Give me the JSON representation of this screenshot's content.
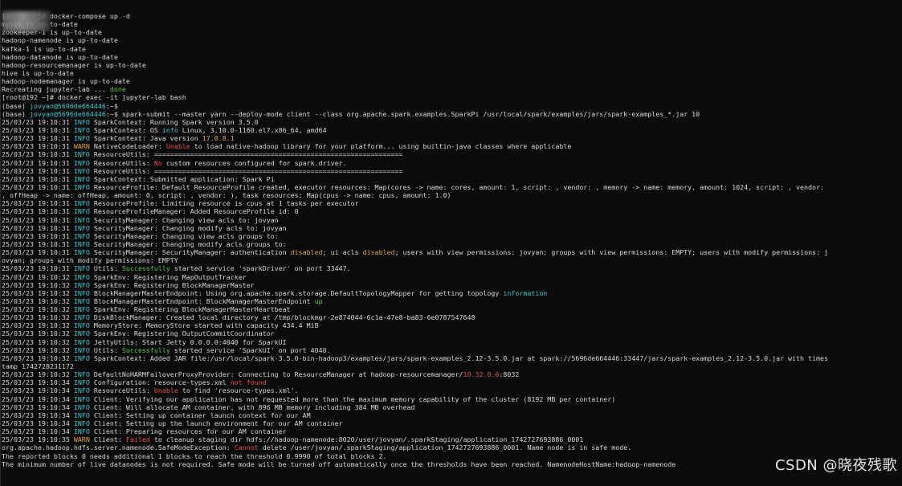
{
  "terminal": {
    "lines": [
      [
        [
          "plain",
          "[r   o   ]# docker-compose up -d"
        ]
      ],
      [
        [
          "plain",
          "mysql is up-to-date"
        ]
      ],
      [
        [
          "plain",
          "zookeeper-1 is up-to-date"
        ]
      ],
      [
        [
          "plain",
          "hadoop-namenode is up-to-date"
        ]
      ],
      [
        [
          "plain",
          "kafka-1 is up-to-date"
        ]
      ],
      [
        [
          "plain",
          "hadoop-datanode is up-to-date"
        ]
      ],
      [
        [
          "plain",
          "hadoop-resourcemanager is up-to-date"
        ]
      ],
      [
        [
          "plain",
          "hive is up-to-date"
        ]
      ],
      [
        [
          "plain",
          "hadoop-nodemanager is up-to-date"
        ]
      ],
      [
        [
          "plain",
          "Recreating jupyter-lab ... "
        ],
        [
          "green",
          "done"
        ]
      ],
      [
        [
          "plain",
          "[root@192 ~]# docker exec -it jupyter-lab bash"
        ]
      ],
      [
        [
          "plain",
          "(base) "
        ],
        [
          "cyan",
          "jovyan@5696de664446"
        ],
        [
          "plain",
          ":~$"
        ]
      ],
      [
        [
          "plain",
          "(base) "
        ],
        [
          "cyan",
          "jovyan@5696de664446"
        ],
        [
          "plain",
          ":~$ spark-submit --master yarn --deploy-mode client --class org.apache.spark.examples.SparkPi /usr/local/spark/examples/jars/spark-examples_*.jar 10"
        ]
      ],
      [
        [
          "plain",
          "25/03/23 19:10:31 "
        ],
        [
          "cyan",
          "INFO"
        ],
        [
          "plain",
          " SparkContext: Running Spark version 3.5.0"
        ]
      ],
      [
        [
          "plain",
          "25/03/23 19:10:31 "
        ],
        [
          "cyan",
          "INFO"
        ],
        [
          "plain",
          " SparkContext: OS "
        ],
        [
          "cyan",
          "info"
        ],
        [
          "plain",
          " Linux, 3.10.0-1160.el7.x86_64, amd64"
        ]
      ],
      [
        [
          "plain",
          "25/03/23 19:10:31 "
        ],
        [
          "cyan",
          "INFO"
        ],
        [
          "plain",
          " SparkContext: Java version "
        ],
        [
          "orange",
          "17.0.8.1"
        ]
      ],
      [
        [
          "plain",
          "25/03/23 19:10:31 "
        ],
        [
          "orange",
          "WARN"
        ],
        [
          "plain",
          " NativeCodeLoader: "
        ],
        [
          "red",
          "Unable"
        ],
        [
          "plain",
          " to load native-hadoop library for your platform... using builtin-java classes where applicable"
        ]
      ],
      [
        [
          "plain",
          "25/03/23 19:10:31 "
        ],
        [
          "cyan",
          "INFO"
        ],
        [
          "plain",
          " ResourceUtils: =============================================================="
        ]
      ],
      [
        [
          "plain",
          "25/03/23 19:10:31 "
        ],
        [
          "cyan",
          "INFO"
        ],
        [
          "plain",
          " ResourceUtils: "
        ],
        [
          "red",
          "No"
        ],
        [
          "plain",
          " custom resources configured for spark.driver."
        ]
      ],
      [
        [
          "plain",
          "25/03/23 19:10:31 "
        ],
        [
          "cyan",
          "INFO"
        ],
        [
          "plain",
          " ResourceUtils: =============================================================="
        ]
      ],
      [
        [
          "plain",
          "25/03/23 19:10:31 "
        ],
        [
          "cyan",
          "INFO"
        ],
        [
          "plain",
          " SparkContext: Submitted application: Spark Pi"
        ]
      ],
      [
        [
          "plain",
          "25/03/23 19:10:31 "
        ],
        [
          "cyan",
          "INFO"
        ],
        [
          "plain",
          " ResourceProfile: Default ResourceProfile created, executor resources: Map(cores -> name: cores, amount: 1, script: , vendor: , memory -> name: memory, amount: 1024, script: , vendor:"
        ]
      ],
      [
        [
          "plain",
          ", offHeap -> name: offHeap, amount: 0, script: , vendor: ), task resources: Map(cpus -> name: cpus, amount: 1.0)"
        ]
      ],
      [
        [
          "plain",
          "25/03/23 19:10:31 "
        ],
        [
          "cyan",
          "INFO"
        ],
        [
          "plain",
          " ResourceProfile: Limiting resource is cpus at 1 tasks per executor"
        ]
      ],
      [
        [
          "plain",
          "25/03/23 19:10:31 "
        ],
        [
          "cyan",
          "INFO"
        ],
        [
          "plain",
          " ResourceProfileManager: Added ResourceProfile id: 0"
        ]
      ],
      [
        [
          "plain",
          "25/03/23 19:10:31 "
        ],
        [
          "cyan",
          "INFO"
        ],
        [
          "plain",
          " SecurityManager: Changing view acls to: jovyan"
        ]
      ],
      [
        [
          "plain",
          "25/03/23 19:10:31 "
        ],
        [
          "cyan",
          "INFO"
        ],
        [
          "plain",
          " SecurityManager: Changing modify acls to: jovyan"
        ]
      ],
      [
        [
          "plain",
          "25/03/23 19:10:31 "
        ],
        [
          "cyan",
          "INFO"
        ],
        [
          "plain",
          " SecurityManager: Changing view acls groups to:"
        ]
      ],
      [
        [
          "plain",
          "25/03/23 19:10:31 "
        ],
        [
          "cyan",
          "INFO"
        ],
        [
          "plain",
          " SecurityManager: Changing modify acls groups to:"
        ]
      ],
      [
        [
          "plain",
          "25/03/23 19:10:31 "
        ],
        [
          "cyan",
          "INFO"
        ],
        [
          "plain",
          " SecurityManager: SecurityManager: authentication "
        ],
        [
          "orange",
          "disabled"
        ],
        [
          "plain",
          "; ui acls "
        ],
        [
          "orange",
          "disabled"
        ],
        [
          "plain",
          "; users with view permissions: jovyan; groups with view permissions: EMPTY; users with modify permissions: j"
        ]
      ],
      [
        [
          "plain",
          "ovyan; groups with modify permissions: EMPTY"
        ]
      ],
      [
        [
          "plain",
          "25/03/23 19:10:31 "
        ],
        [
          "cyan",
          "INFO"
        ],
        [
          "plain",
          " Utils: "
        ],
        [
          "green",
          "Successfully"
        ],
        [
          "plain",
          " started service 'sparkDriver' on port 33447."
        ]
      ],
      [
        [
          "plain",
          "25/03/23 19:10:32 "
        ],
        [
          "cyan",
          "INFO"
        ],
        [
          "plain",
          " SparkEnv: Registering MapOutputTracker"
        ]
      ],
      [
        [
          "plain",
          "25/03/23 19:10:32 "
        ],
        [
          "cyan",
          "INFO"
        ],
        [
          "plain",
          " SparkEnv: Registering BlockManagerMaster"
        ]
      ],
      [
        [
          "plain",
          "25/03/23 19:10:32 "
        ],
        [
          "cyan",
          "INFO"
        ],
        [
          "plain",
          " BlockManagerMasterEndpoint: Using org.apache.spark.storage.DefaultTopologyMapper for getting topology "
        ],
        [
          "cyan",
          "information"
        ]
      ],
      [
        [
          "plain",
          "25/03/23 19:10:32 "
        ],
        [
          "cyan",
          "INFO"
        ],
        [
          "plain",
          " BlockManagerMasterEndpoint: BlockManagerMasterEndpoint "
        ],
        [
          "green",
          "up"
        ]
      ],
      [
        [
          "plain",
          "25/03/23 19:10:32 "
        ],
        [
          "cyan",
          "INFO"
        ],
        [
          "plain",
          " SparkEnv: Registering BlockManagerMasterHeartbeat"
        ]
      ],
      [
        [
          "plain",
          "25/03/23 19:10:32 "
        ],
        [
          "cyan",
          "INFO"
        ],
        [
          "plain",
          " DiskBlockManager: Created local directory at /tmp/blockmgr-2e874044-6c1a-47e8-ba83-6e0787547648"
        ]
      ],
      [
        [
          "plain",
          "25/03/23 19:10:32 "
        ],
        [
          "cyan",
          "INFO"
        ],
        [
          "plain",
          " MemoryStore: MemoryStore started with capacity 434.4 MiB"
        ]
      ],
      [
        [
          "plain",
          "25/03/23 19:10:32 "
        ],
        [
          "cyan",
          "INFO"
        ],
        [
          "plain",
          " SparkEnv: Registering OutputCommitCoordinator"
        ]
      ],
      [
        [
          "plain",
          "25/03/23 19:10:32 "
        ],
        [
          "cyan",
          "INFO"
        ],
        [
          "plain",
          " JettyUtils: Start Jetty 0.0.0.0:4040 for SparkUI"
        ]
      ],
      [
        [
          "plain",
          "25/03/23 19:10:32 "
        ],
        [
          "cyan",
          "INFO"
        ],
        [
          "plain",
          " Utils: "
        ],
        [
          "green",
          "Successfully"
        ],
        [
          "plain",
          " started service 'SparkUI' on port 4040."
        ]
      ],
      [
        [
          "plain",
          "25/03/23 19:10:32 "
        ],
        [
          "cyan",
          "INFO"
        ],
        [
          "plain",
          " SparkContext: Added JAR file:/usr/local/spark-3.5.0-bin-hadoop3/examples/jars/spark-examples_2.12-3.5.0.jar at spark://5696de664446:33447/jars/spark-examples_2.12-3.5.0.jar with times"
        ]
      ],
      [
        [
          "plain",
          "tamp 1742728231172"
        ]
      ],
      [
        [
          "plain",
          "25/03/23 19:10:32 "
        ],
        [
          "cyan",
          "INFO"
        ],
        [
          "plain",
          " DefaultNoHARMFailoverProxyProvider: Connecting to ResourceManager at hadoop-resourcemanager/"
        ],
        [
          "red",
          "10.32.0.6"
        ],
        [
          "plain",
          ":8032"
        ]
      ],
      [
        [
          "plain",
          "25/03/23 19:10:34 "
        ],
        [
          "cyan",
          "INFO"
        ],
        [
          "plain",
          " Configuration: resource-types.xml "
        ],
        [
          "red",
          "not found"
        ]
      ],
      [
        [
          "plain",
          "25/03/23 19:10:34 "
        ],
        [
          "cyan",
          "INFO"
        ],
        [
          "plain",
          " ResourceUtils: "
        ],
        [
          "red",
          "Unable"
        ],
        [
          "plain",
          " to find 'resource-types.xml'."
        ]
      ],
      [
        [
          "plain",
          "25/03/23 19:10:34 "
        ],
        [
          "cyan",
          "INFO"
        ],
        [
          "plain",
          " Client: Verifying our application has not requested more than the maximum memory capability of the cluster (8192 MB per container)"
        ]
      ],
      [
        [
          "plain",
          "25/03/23 19:10:34 "
        ],
        [
          "cyan",
          "INFO"
        ],
        [
          "plain",
          " Client: Will allocate AM container, with 896 MB memory including 384 MB overhead"
        ]
      ],
      [
        [
          "plain",
          "25/03/23 19:10:34 "
        ],
        [
          "cyan",
          "INFO"
        ],
        [
          "plain",
          " Client: Setting up container launch context for our AM"
        ]
      ],
      [
        [
          "plain",
          "25/03/23 19:10:34 "
        ],
        [
          "cyan",
          "INFO"
        ],
        [
          "plain",
          " Client: Setting up the launch environment for our AM container"
        ]
      ],
      [
        [
          "plain",
          "25/03/23 19:10:34 "
        ],
        [
          "cyan",
          "INFO"
        ],
        [
          "plain",
          " Client: Preparing resources for our AM container"
        ]
      ],
      [
        [
          "plain",
          "25/03/23 19:10:35 "
        ],
        [
          "orange",
          "WARN"
        ],
        [
          "plain",
          " Client: "
        ],
        [
          "red",
          "Failed"
        ],
        [
          "plain",
          " to cleanup staging dir hdfs://hadoop-namenode:8020/user/jovyan/.sparkStaging/application_1742727693886_0001"
        ]
      ],
      [
        [
          "plain",
          "org.apache.hadoop.hdfs.server.namenode.SafeModeException: "
        ],
        [
          "red",
          "Cannot"
        ],
        [
          "plain",
          " delete /user/jovyan/.sparkStaging/application_1742727693886_0001. Name node is in safe mode."
        ]
      ],
      [
        [
          "plain",
          "The reported blocks 0 needs additional 1 blocks to reach the threshold 0.9990 of total blocks 2."
        ]
      ],
      [
        [
          "plain",
          "The minimum number of live datanodes is not required. Safe mode will be turned off automatically once the thresholds have been reached. NamenodeHostName:hadoop-namenode"
        ]
      ]
    ]
  },
  "watermark": "CSDN @晓夜残歌",
  "colors": {
    "background": "#0b0b0b",
    "text": "#d8d8d8",
    "info": "#3fc7d4",
    "error": "#e0504a",
    "warn": "#e0a238",
    "success": "#58c84a"
  }
}
